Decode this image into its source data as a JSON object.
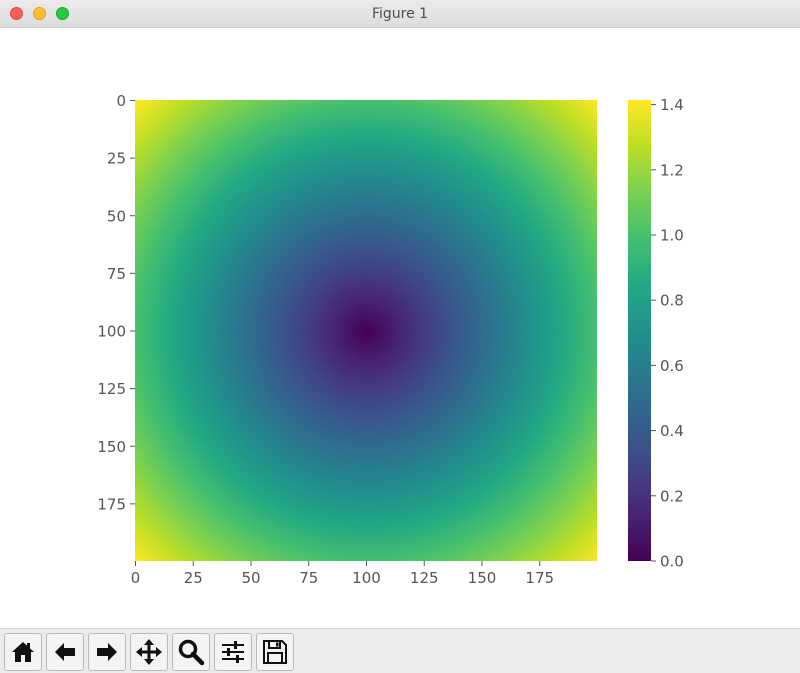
{
  "window": {
    "title": "Figure 1"
  },
  "toolbar": {
    "buttons": [
      {
        "name": "home",
        "icon": "home-icon"
      },
      {
        "name": "back",
        "icon": "arrow-left-icon"
      },
      {
        "name": "forward",
        "icon": "arrow-right-icon"
      },
      {
        "name": "pan",
        "icon": "move-icon"
      },
      {
        "name": "zoom",
        "icon": "magnifier-icon"
      },
      {
        "name": "configure-subplots",
        "icon": "sliders-icon"
      },
      {
        "name": "save",
        "icon": "floppy-disk-icon"
      }
    ]
  },
  "chart_data": {
    "type": "heatmap",
    "colormap": "viridis",
    "description_values": "distance from center (100,100) normalized by 100",
    "grid_shape": [
      200,
      200
    ],
    "center": [
      100,
      100
    ],
    "value_range": [
      0.0,
      1.414
    ],
    "x_ticks": [
      "0",
      "25",
      "50",
      "75",
      "100",
      "125",
      "150",
      "175"
    ],
    "x_tick_values": [
      0,
      25,
      50,
      75,
      100,
      125,
      150,
      175
    ],
    "y_ticks": [
      "0",
      "25",
      "50",
      "75",
      "100",
      "125",
      "150",
      "175"
    ],
    "y_tick_values": [
      0,
      25,
      50,
      75,
      100,
      125,
      150,
      175
    ],
    "xlim": [
      0,
      200
    ],
    "ylim": [
      200,
      0
    ],
    "colorbar": {
      "ticks": [
        "0.0",
        "0.2",
        "0.4",
        "0.6",
        "0.8",
        "1.0",
        "1.2",
        "1.4"
      ],
      "tick_values": [
        0.0,
        0.2,
        0.4,
        0.6,
        0.8,
        1.0,
        1.2,
        1.4
      ],
      "range": [
        0.0,
        1.414
      ]
    },
    "grid": false
  }
}
